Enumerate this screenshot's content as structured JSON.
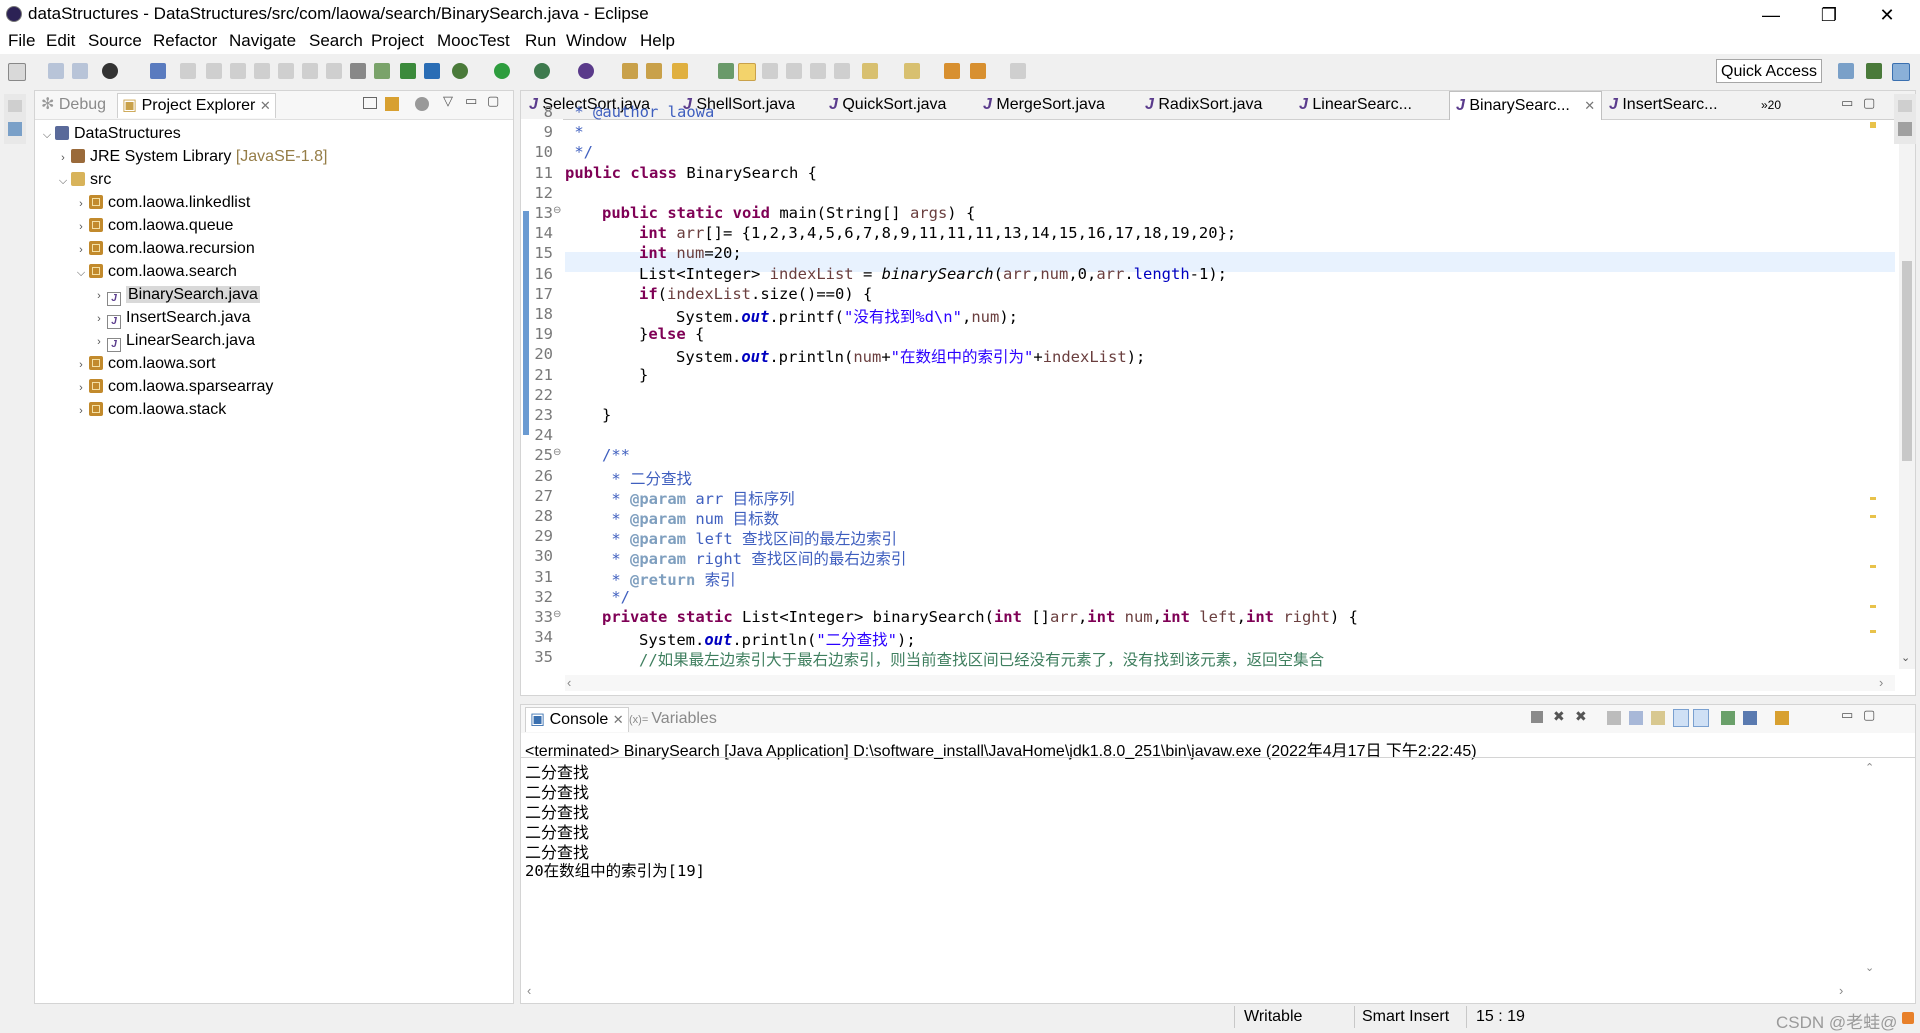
{
  "window": {
    "title": "dataStructures - DataStructures/src/com/laowa/search/BinarySearch.java - Eclipse",
    "minimize": "—",
    "maximize": "❐",
    "close": "✕"
  },
  "menu": [
    "File",
    "Edit",
    "Source",
    "Refactor",
    "Navigate",
    "Search",
    "Project",
    "MoocTest",
    "Run",
    "Window",
    "Help"
  ],
  "toolbar": {
    "quick_access": "Quick Access"
  },
  "left_panel": {
    "tabs": [
      {
        "label": "Debug"
      },
      {
        "label": "Project Explorer"
      }
    ],
    "tree": [
      {
        "label": "DataStructures",
        "icon": "project-icon",
        "expanded": true
      },
      {
        "label": "JRE System Library",
        "suffix": "[JavaSE-1.8]",
        "icon": "library-icon"
      },
      {
        "label": "src",
        "icon": "src-folder-icon",
        "expanded": true
      },
      {
        "label": "com.laowa.linkedlist",
        "icon": "package-icon"
      },
      {
        "label": "com.laowa.queue",
        "icon": "package-icon"
      },
      {
        "label": "com.laowa.recursion",
        "icon": "package-icon"
      },
      {
        "label": "com.laowa.search",
        "icon": "package-icon",
        "expanded": true
      },
      {
        "label": "BinarySearch.java",
        "icon": "java-file-icon",
        "selected": true
      },
      {
        "label": "InsertSearch.java",
        "icon": "java-file-icon"
      },
      {
        "label": "LinearSearch.java",
        "icon": "java-file-icon"
      },
      {
        "label": "com.laowa.sort",
        "icon": "package-icon"
      },
      {
        "label": "com.laowa.sparsearray",
        "icon": "package-icon"
      },
      {
        "label": "com.laowa.stack",
        "icon": "package-icon"
      }
    ]
  },
  "editor": {
    "tabs": [
      "SelectSort.java",
      "ShellSort.java",
      "QuickSort.java",
      "MergeSort.java",
      "RadixSort.java",
      "LinearSearc...",
      "BinarySearc...",
      "InsertSearc..."
    ],
    "active_tab": "BinarySearc...",
    "overflow_count": "»20",
    "line_numbers": [
      "8",
      "9",
      "10",
      "11",
      "12",
      "13",
      "14",
      "15",
      "16",
      "17",
      "18",
      "19",
      "20",
      "21",
      "22",
      "23",
      "24",
      "25",
      "26",
      "27",
      "28",
      "29",
      "30",
      "31",
      "32",
      "33",
      "34",
      "35"
    ],
    "code": {
      "l8": " * @author laowa",
      "l9": " *",
      "l10": " */",
      "l11_kw": "public class",
      "l11_rest": " BinarySearch {",
      "l13_kw": "public static void",
      "l13_rest": " main(String[] ",
      "l13_var": "args",
      "l13_end": ") {",
      "l14_kw": "int",
      "l14_var": " arr",
      "l14_rest": "[]= {1,2,3,4,5,6,7,8,9,11,11,11,13,14,15,16,17,18,19,20};",
      "l15_kw": "int",
      "l15_var": " num",
      "l15_rest": "=20;",
      "l16_a": "List<Integer> ",
      "l16_var": "indexList",
      "l16_b": " = ",
      "l16_m": "binarySearch",
      "l16_c": "(",
      "l16_v1": "arr",
      "l16_d": ",",
      "l16_v2": "num",
      "l16_e": ",0,",
      "l16_v3": "arr",
      "l16_f": ".",
      "l16_fld": "length",
      "l16_g": "-1);",
      "l17_kw": "if",
      "l17_a": "(",
      "l17_var": "indexList",
      "l17_b": ".size()==0) {",
      "l18_a": "System.",
      "l18_stat": "out",
      "l18_b": ".printf(",
      "l18_str": "\"没有找到%d\\n\"",
      "l18_c": ",",
      "l18_var": "num",
      "l18_d": ");",
      "l19_a": "}",
      "l19_kw": "else",
      "l19_b": " {",
      "l20_a": "System.",
      "l20_stat": "out",
      "l20_b": ".println(",
      "l20_var": "num",
      "l20_c": "+",
      "l20_str": "\"在数组中的索引为\"",
      "l20_d": "+",
      "l20_var2": "indexList",
      "l20_e": ");",
      "l21": "}",
      "l23": "}",
      "l25": "/**",
      "l26": " * 二分查找",
      "l27_tag": "@param",
      "l27_rest": " arr 目标序列",
      "l28_tag": "@param",
      "l28_rest": " num 目标数",
      "l29_tag": "@param",
      "l29_rest": " left 查找区间的最左边索引",
      "l30_tag": "@param",
      "l30_rest": " right 查找区间的最右边索引",
      "l31_tag": "@return",
      "l31_rest": " 索引",
      "l32": " */",
      "l33_kw": "private static",
      "l33_a": " List<Integer> binarySearch(",
      "l33_kw2": "int",
      "l33_b": " []",
      "l33_v1": "arr",
      "l33_c": ",",
      "l33_kw3": "int",
      "l33_v2": " num",
      "l33_d": ",",
      "l33_kw4": "int",
      "l33_v3": " left",
      "l33_e": ",",
      "l33_kw5": "int",
      "l33_v4": " right",
      "l33_f": ") {",
      "l34_a": "System.",
      "l34_stat": "out",
      "l34_b": ".println(",
      "l34_str": "\"二分查找\"",
      "l34_c": ");",
      "l35": "//如果最左边索引大于最右边索引，则当前查找区间已经没有元素了，没有找到该元素，返回空集合"
    }
  },
  "console": {
    "tabs": [
      {
        "label": "Console"
      },
      {
        "label": "Variables"
      }
    ],
    "header": "<terminated> BinarySearch [Java Application] D:\\software_install\\JavaHome\\jdk1.8.0_251\\bin\\javaw.exe (2022年4月17日 下午2:22:45)",
    "output": [
      "二分查找",
      "二分查找",
      "二分查找",
      "二分查找",
      "二分查找",
      "20在数组中的索引为[19]"
    ]
  },
  "status_bar": {
    "writable": "Writable",
    "insert_mode": "Smart Insert",
    "position": "15 : 19",
    "watermark": "CSDN @老蛙@"
  },
  "colors": {
    "keyword": "#7f0055",
    "string": "#2a00ff",
    "javadoc": "#3f5fbf",
    "line_comment": "#3f7f5f",
    "highlight_line": "#e8f2fe"
  }
}
